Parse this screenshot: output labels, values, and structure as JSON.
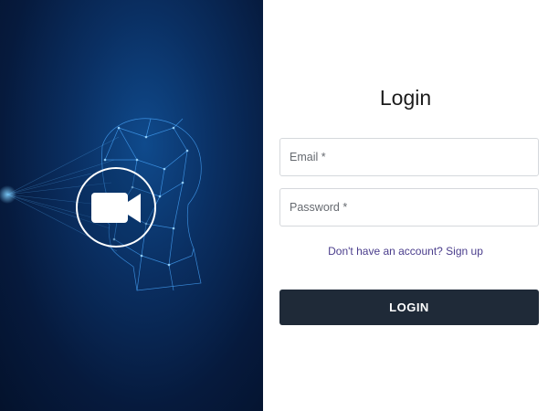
{
  "login": {
    "title": "Login",
    "email_placeholder": "Email *",
    "password_placeholder": "Password *",
    "signup_link": "Don't have an account? Sign up",
    "login_button": "LOGIN"
  },
  "hero": {
    "icon": "video-camera-icon",
    "illustration": "wireframe-face-illustration"
  },
  "colors": {
    "hero_background": "#061a3d",
    "button_background": "#1f2a38",
    "link": "#4a3d8c"
  }
}
